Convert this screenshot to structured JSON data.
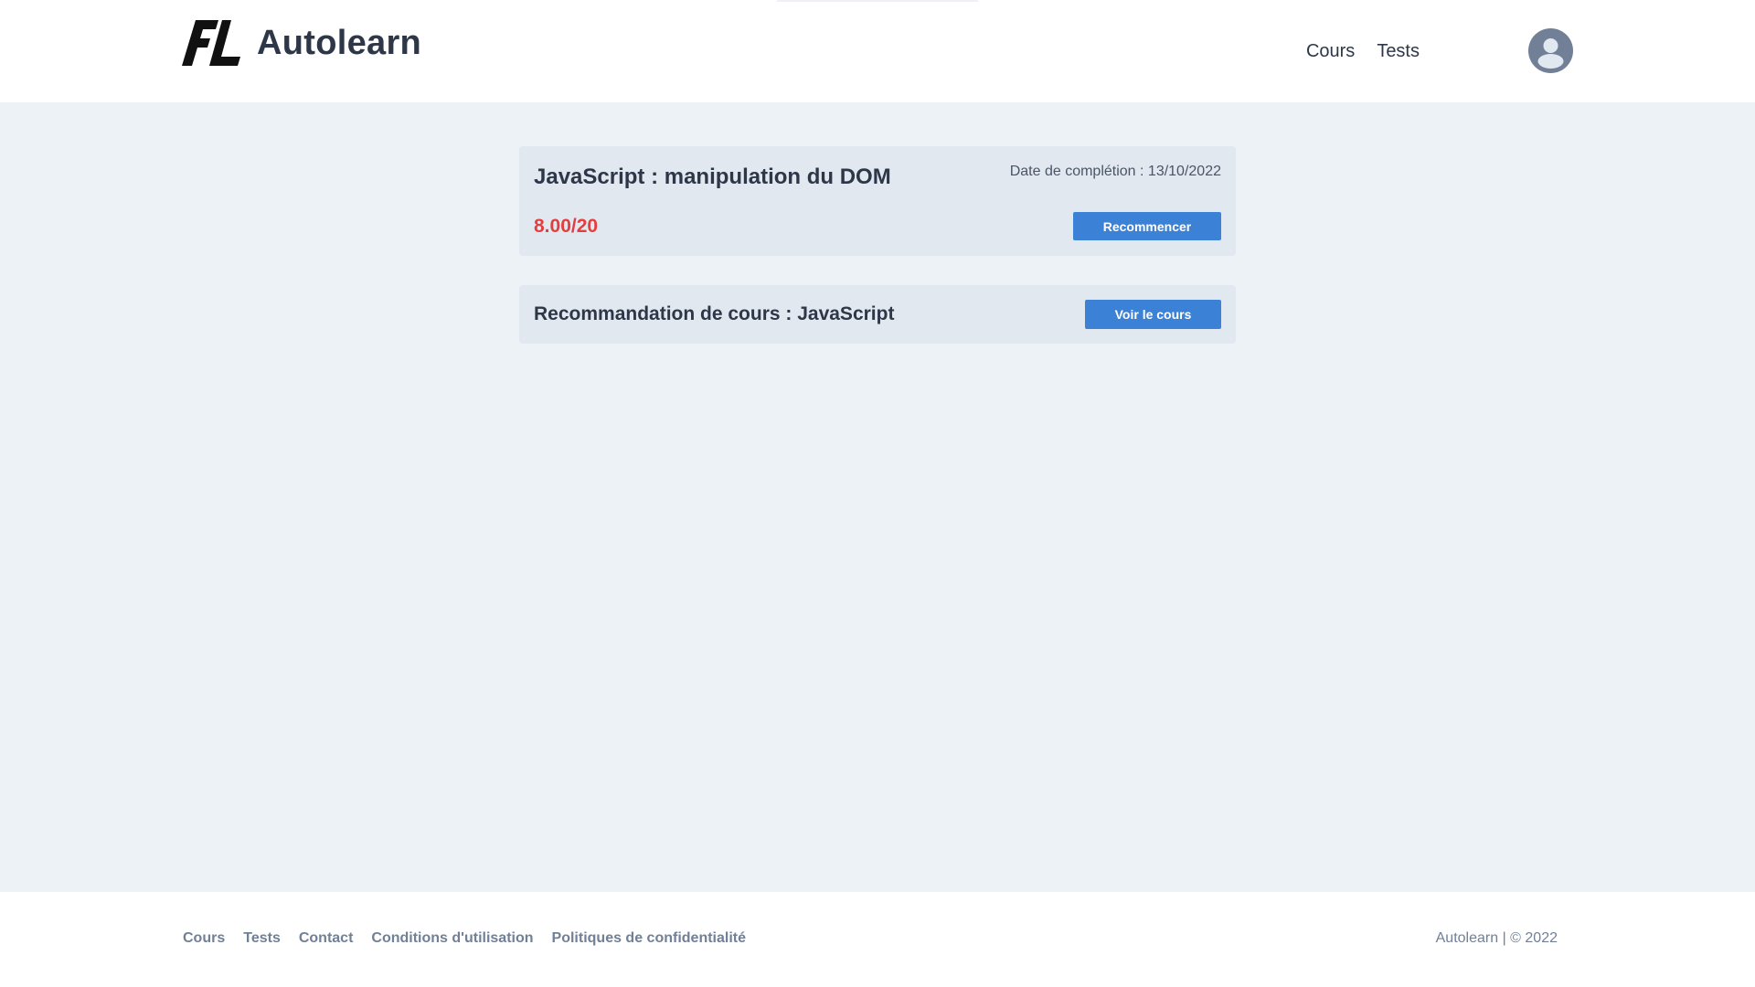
{
  "header": {
    "brand_name": "Autolearn",
    "nav": {
      "courses": "Cours",
      "tests": "Tests"
    },
    "avatar_icon": "user-avatar-icon"
  },
  "result": {
    "title": "JavaScript : manipulation du DOM",
    "completion_date": "Date de complétion : 13/10/2022",
    "score": "8.00/20",
    "restart_label": "Recommencer"
  },
  "recommendation": {
    "title": "Recommandation de cours : JavaScript",
    "view_course_label": "Voir le cours"
  },
  "footer": {
    "links": {
      "courses": "Cours",
      "tests": "Tests",
      "contact": "Contact",
      "terms": "Conditions d'utilisation",
      "privacy": "Politiques de confidentialité"
    },
    "copyright": "Autolearn | © 2022"
  },
  "colors": {
    "accent": "#3b82d6",
    "score_fail": "#e53e3e",
    "background": "#edf2f7",
    "card": "#e2e8f0",
    "text": "#2d3748"
  }
}
